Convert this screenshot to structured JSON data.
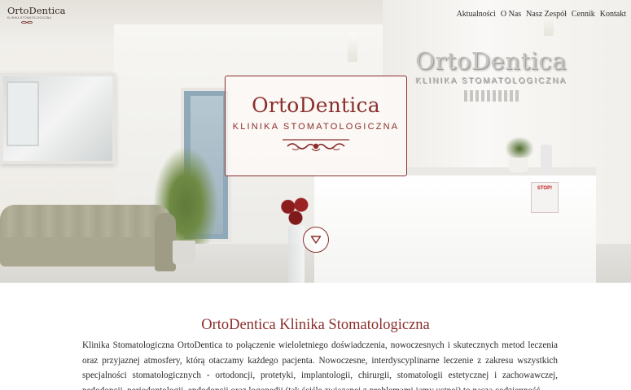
{
  "brand": {
    "name": "OrtoDentica",
    "subtitle": "KLINIKA STOMATOLOGICZNA"
  },
  "nav": {
    "items": [
      {
        "label": "Aktualności"
      },
      {
        "label": "O Nas"
      },
      {
        "label": "Nasz Zespół"
      },
      {
        "label": "Cennik"
      },
      {
        "label": "Kontakt"
      }
    ]
  },
  "hero": {
    "card_title": "OrtoDentica",
    "card_subtitle": "KLINIKA STOMATOLOGICZNA",
    "wall_sign_title": "OrtoDentica",
    "wall_sign_subtitle": "KLINIKA STOMATOLOGICZNA",
    "stop_sign_text": "STOP!",
    "scroll_icon": "chevron-down-icon"
  },
  "colors": {
    "accent": "#8a2f2c",
    "text": "#2a2a2a"
  },
  "main": {
    "heading": "OrtoDentica Klinika Stomatologiczna",
    "body": "Klinika Stomatologiczna OrtoDentica to połączenie wieloletniego doświadczenia, nowoczesnych i skutecznych metod leczenia oraz przyjaznej atmosfery, którą otaczamy każdego pacjenta. Nowoczesne, interdyscyplinarne leczenie z zakresu wszystkich specjalności stomatologicznych - ortodoncji, protetyki, implantologii, chirurgii, stomatologii estetycznej i zachowawczej, pedodoncji, periodontologii, endodoncji oraz logopedii (tak ściśle związanej z problemami jamy ustnej) to nasza codzienność."
  }
}
